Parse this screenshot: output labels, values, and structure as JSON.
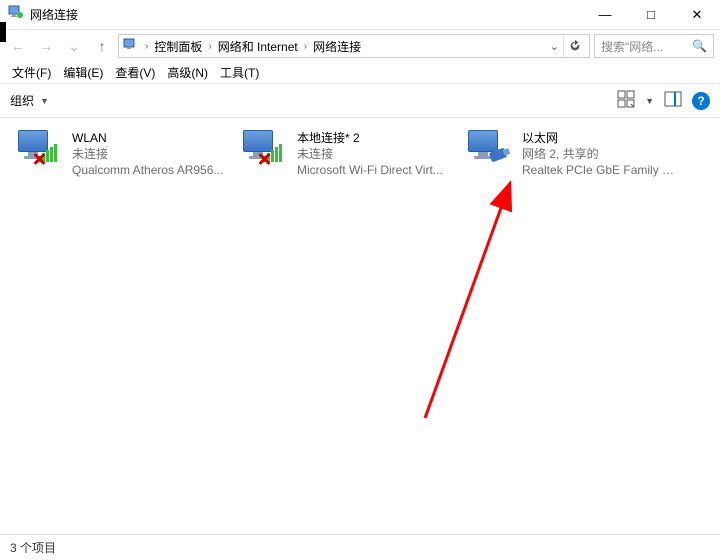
{
  "window": {
    "title": "网络连接",
    "controls": {
      "min": "—",
      "max": "□",
      "close": "✕"
    }
  },
  "nav": {
    "back_tip": "返回",
    "fwd_tip": "前进",
    "up_tip": "上移",
    "dd_tip": "最近",
    "refresh_tip": "刷新",
    "dropdown_glyph": "⌄"
  },
  "breadcrumbs": {
    "sep": "›",
    "items": [
      "控制面板",
      "网络和 Internet",
      "网络连接"
    ]
  },
  "search": {
    "placeholder": "搜索\"网络...",
    "icon_glyph": "🔍"
  },
  "menu": {
    "items": [
      "文件(F)",
      "编辑(E)",
      "查看(V)",
      "高级(N)",
      "工具(T)"
    ]
  },
  "toolbar": {
    "organize": "组织",
    "caret": "▼",
    "help_glyph": "?"
  },
  "connections": [
    {
      "name": "WLAN",
      "status": "未连接",
      "device": "Qualcomm Atheros AR956...",
      "icon_type": "wifi_disconnected"
    },
    {
      "name": "本地连接* 2",
      "status": "未连接",
      "device": "Microsoft Wi-Fi Direct Virt...",
      "icon_type": "wifi_disconnected"
    },
    {
      "name": "以太网",
      "status": "网络 2, 共享的",
      "device": "Realtek PCIe GbE Family C...",
      "icon_type": "ethernet"
    }
  ],
  "status": {
    "text": "3 个项目"
  },
  "annotation": {
    "color": "#ff0000"
  }
}
